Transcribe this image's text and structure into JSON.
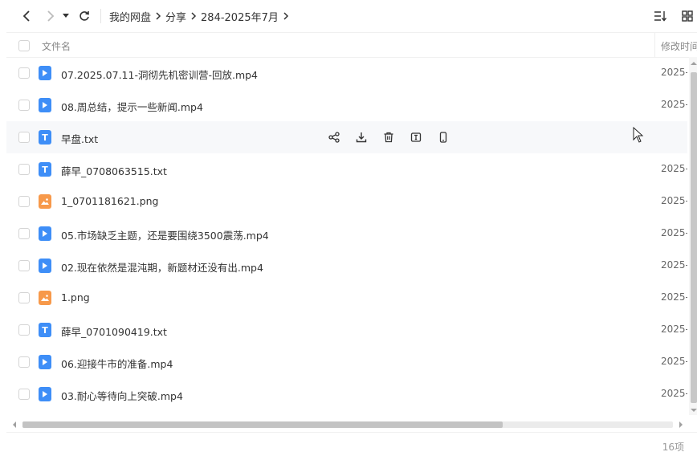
{
  "breadcrumb": [
    "我的网盘",
    "分享",
    "284-2025年7月"
  ],
  "header": {
    "name_col": "文件名",
    "date_col": "修改时间"
  },
  "files": [
    {
      "name": "07.2025.07.11-洞彻先机密训营-回放.mp4",
      "type": "video",
      "date": "2025-"
    },
    {
      "name": "08.周总结，提示一些新闻.mp4",
      "type": "video",
      "date": "2025-"
    },
    {
      "name": "早盘.txt",
      "type": "text",
      "date": ""
    },
    {
      "name": "薛早_0708063515.txt",
      "type": "text",
      "date": "2025-"
    },
    {
      "name": "1_0701181621.png",
      "type": "image",
      "date": "2025-"
    },
    {
      "name": "05.市场缺乏主题，还是要围绕3500震荡.mp4",
      "type": "video",
      "date": "2025-"
    },
    {
      "name": "02.现在依然是混沌期，新题材还没有出.mp4",
      "type": "video",
      "date": "2025-"
    },
    {
      "name": "1.png",
      "type": "image",
      "date": "2025-"
    },
    {
      "name": "薛早_0701090419.txt",
      "type": "text",
      "date": "2025-"
    },
    {
      "name": "06.迎接牛市的准备.mp4",
      "type": "video",
      "date": "2025-"
    },
    {
      "name": "03.耐心等待向上突破.mp4",
      "type": "video",
      "date": "2025-"
    }
  ],
  "text_icon_letter": "T",
  "hover_row_index": 2,
  "hover_actions": [
    "share-icon",
    "download-icon",
    "delete-icon",
    "rename-icon",
    "phone-icon"
  ],
  "footer": {
    "count": "16项"
  },
  "colors": {
    "video_icon": "#3e8ef7",
    "text_icon": "#3e8ef7",
    "image_icon": "#f7994a",
    "hover_row": "#f7f8fa"
  }
}
